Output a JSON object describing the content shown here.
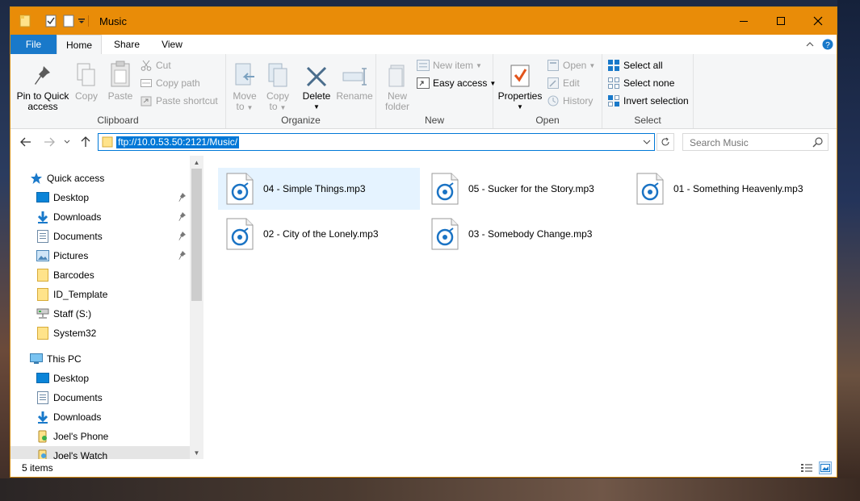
{
  "window": {
    "title": "Music"
  },
  "tabs": {
    "file": "File",
    "home": "Home",
    "share": "Share",
    "view": "View"
  },
  "ribbon": {
    "clipboard": {
      "label": "Clipboard",
      "pin": "Pin to Quick access",
      "pin_line1": "Pin to Quick",
      "pin_line2": "access",
      "copy": "Copy",
      "paste": "Paste",
      "cut": "Cut",
      "copy_path": "Copy path",
      "paste_shortcut": "Paste shortcut"
    },
    "organize": {
      "label": "Organize",
      "move_to_line1": "Move",
      "move_to_line2": "to",
      "copy_to_line1": "Copy",
      "copy_to_line2": "to",
      "delete": "Delete",
      "rename": "Rename"
    },
    "new": {
      "label": "New",
      "new_folder_line1": "New",
      "new_folder_line2": "folder",
      "new_item": "New item",
      "easy_access": "Easy access"
    },
    "open": {
      "label": "Open",
      "properties": "Properties",
      "open": "Open",
      "edit": "Edit",
      "history": "History"
    },
    "select": {
      "label": "Select",
      "select_all": "Select all",
      "select_none": "Select none",
      "invert": "Invert selection"
    }
  },
  "address": {
    "path": "ftp://10.0.53.50:2121/Music/",
    "search_placeholder": "Search Music"
  },
  "nav": {
    "quick_access": "Quick access",
    "items": [
      {
        "label": "Desktop",
        "pinned": true
      },
      {
        "label": "Downloads",
        "pinned": true
      },
      {
        "label": "Documents",
        "pinned": true
      },
      {
        "label": "Pictures",
        "pinned": true
      },
      {
        "label": "Barcodes"
      },
      {
        "label": "ID_Template"
      },
      {
        "label": "Staff (S:)"
      },
      {
        "label": "System32"
      }
    ],
    "this_pc": "This PC",
    "pc_items": [
      {
        "label": "Desktop"
      },
      {
        "label": "Documents"
      },
      {
        "label": "Downloads"
      },
      {
        "label": "Joel's Phone"
      },
      {
        "label": "Joel's Watch"
      }
    ]
  },
  "files": [
    {
      "name": "04 - Simple Things.mp3",
      "selected": true
    },
    {
      "name": "05 - Sucker for the Story.mp3"
    },
    {
      "name": "01 - Something Heavenly.mp3"
    },
    {
      "name": "02 - City of the Lonely.mp3"
    },
    {
      "name": "03 - Somebody Change.mp3"
    }
  ],
  "status": {
    "count": "5 items"
  },
  "colors": {
    "titlebar": "#e98c08",
    "accent": "#1979ca",
    "selection": "#e5f3ff"
  }
}
